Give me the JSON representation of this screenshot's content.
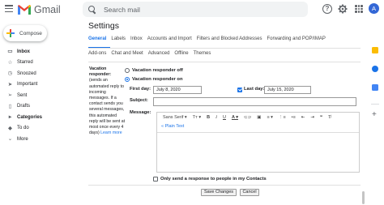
{
  "app": {
    "name": "Gmail",
    "avatar_letter": "A",
    "accent": "#1a73e8"
  },
  "search": {
    "placeholder": "Search mail"
  },
  "sidebar": {
    "compose_label": "Compose",
    "items": [
      {
        "label": "Inbox",
        "icon": "inbox-icon",
        "bold": true
      },
      {
        "label": "Starred",
        "icon": "star-icon"
      },
      {
        "label": "Snoozed",
        "icon": "clock-icon"
      },
      {
        "label": "Important",
        "icon": "label-important-icon"
      },
      {
        "label": "Sent",
        "icon": "send-icon"
      },
      {
        "label": "Drafts",
        "icon": "draft-icon"
      },
      {
        "label": "Categories",
        "icon": "chevron-right-icon",
        "bold": true
      },
      {
        "label": "To do",
        "icon": "label-icon"
      },
      {
        "label": "More",
        "icon": "chevron-down-icon"
      }
    ]
  },
  "settings": {
    "title": "Settings",
    "tabs_row1": [
      "General",
      "Labels",
      "Inbox",
      "Accounts and Import",
      "Filters and Blocked Addresses",
      "Forwarding and POP/IMAP"
    ],
    "tabs_row2": [
      "Add-ons",
      "Chat and Meet",
      "Advanced",
      "Offline",
      "Themes"
    ],
    "active_tab": "General"
  },
  "vacation": {
    "label_title": "Vacation responder:",
    "label_desc": "(sends an automated reply to incoming messages. If a contact sends you several messages, this automated reply will be sent at most once every 4 days)",
    "learn_more": "Learn more",
    "off_label": "Vacation responder off",
    "on_label": "Vacation responder on",
    "selected": "on",
    "first_day_label": "First day:",
    "first_day_value": "July 8, 2020",
    "last_day_label": "Last day:",
    "last_day_value": "July 15, 2020",
    "last_day_checked": true,
    "subject_label": "Subject:",
    "subject_value": "",
    "message_label": "Message:",
    "font_name": "Sans Serif",
    "plain_text_link": "« Plain Text",
    "contacts_only_label": "Only send a response to people in my Contacts",
    "save_button": "Save Changes",
    "cancel_button": "Cancel"
  }
}
